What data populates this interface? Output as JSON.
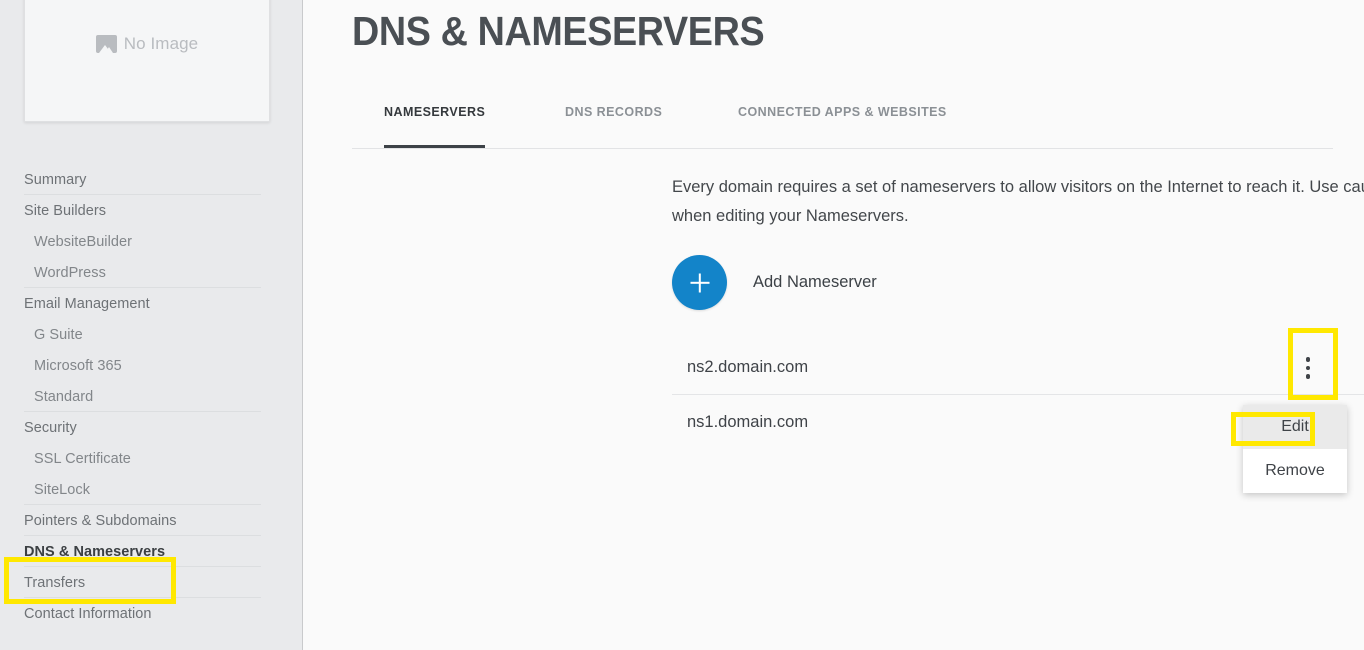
{
  "sidebar": {
    "thumbnail": {
      "label": "No Image",
      "icon": "image-placeholder-icon"
    },
    "items": [
      {
        "label": "Summary",
        "level": "top",
        "active": false,
        "separator": true
      },
      {
        "label": "Site Builders",
        "level": "top",
        "active": false,
        "separator": false
      },
      {
        "label": "WebsiteBuilder",
        "level": "sub",
        "active": false,
        "separator": false
      },
      {
        "label": "WordPress",
        "level": "sub",
        "active": false,
        "separator": true
      },
      {
        "label": "Email Management",
        "level": "top",
        "active": false,
        "separator": false
      },
      {
        "label": "G Suite",
        "level": "sub",
        "active": false,
        "separator": false
      },
      {
        "label": "Microsoft 365",
        "level": "sub",
        "active": false,
        "separator": false
      },
      {
        "label": "Standard",
        "level": "sub",
        "active": false,
        "separator": true
      },
      {
        "label": "Security",
        "level": "top",
        "active": false,
        "separator": false
      },
      {
        "label": "SSL Certificate",
        "level": "sub",
        "active": false,
        "separator": false
      },
      {
        "label": "SiteLock",
        "level": "sub",
        "active": false,
        "separator": true
      },
      {
        "label": "Pointers & Subdomains",
        "level": "top",
        "active": false,
        "separator": true
      },
      {
        "label": "DNS & Nameservers",
        "level": "top",
        "active": true,
        "separator": true
      },
      {
        "label": "Transfers",
        "level": "top",
        "active": false,
        "separator": true
      },
      {
        "label": "Contact Information",
        "level": "top",
        "active": false,
        "separator": false
      }
    ]
  },
  "main": {
    "title": "DNS & NAMESERVERS",
    "tabs": [
      {
        "label": "NAMESERVERS",
        "active": true
      },
      {
        "label": "DNS RECORDS",
        "active": false
      },
      {
        "label": "CONNECTED APPS & WEBSITES",
        "active": false
      }
    ],
    "description": "Every domain requires a set of nameservers to allow visitors on the Internet to reach it. Use caution when editing your Nameservers.",
    "add_nameserver_label": "Add Nameserver",
    "nameservers": [
      {
        "host": "ns2.domain.com"
      },
      {
        "host": "ns1.domain.com"
      }
    ],
    "row_menu": {
      "trigger_icon": "kebab-menu-icon",
      "items": [
        {
          "label": "Edit",
          "hovered": true
        },
        {
          "label": "Remove",
          "hovered": false
        }
      ]
    }
  },
  "annotations": {
    "highlight_color": "#ffe800",
    "accent_color": "#1384c9",
    "targets": [
      "sidebar-item-dns-nameservers",
      "row-kebab-menu",
      "menu-item-edit"
    ]
  }
}
